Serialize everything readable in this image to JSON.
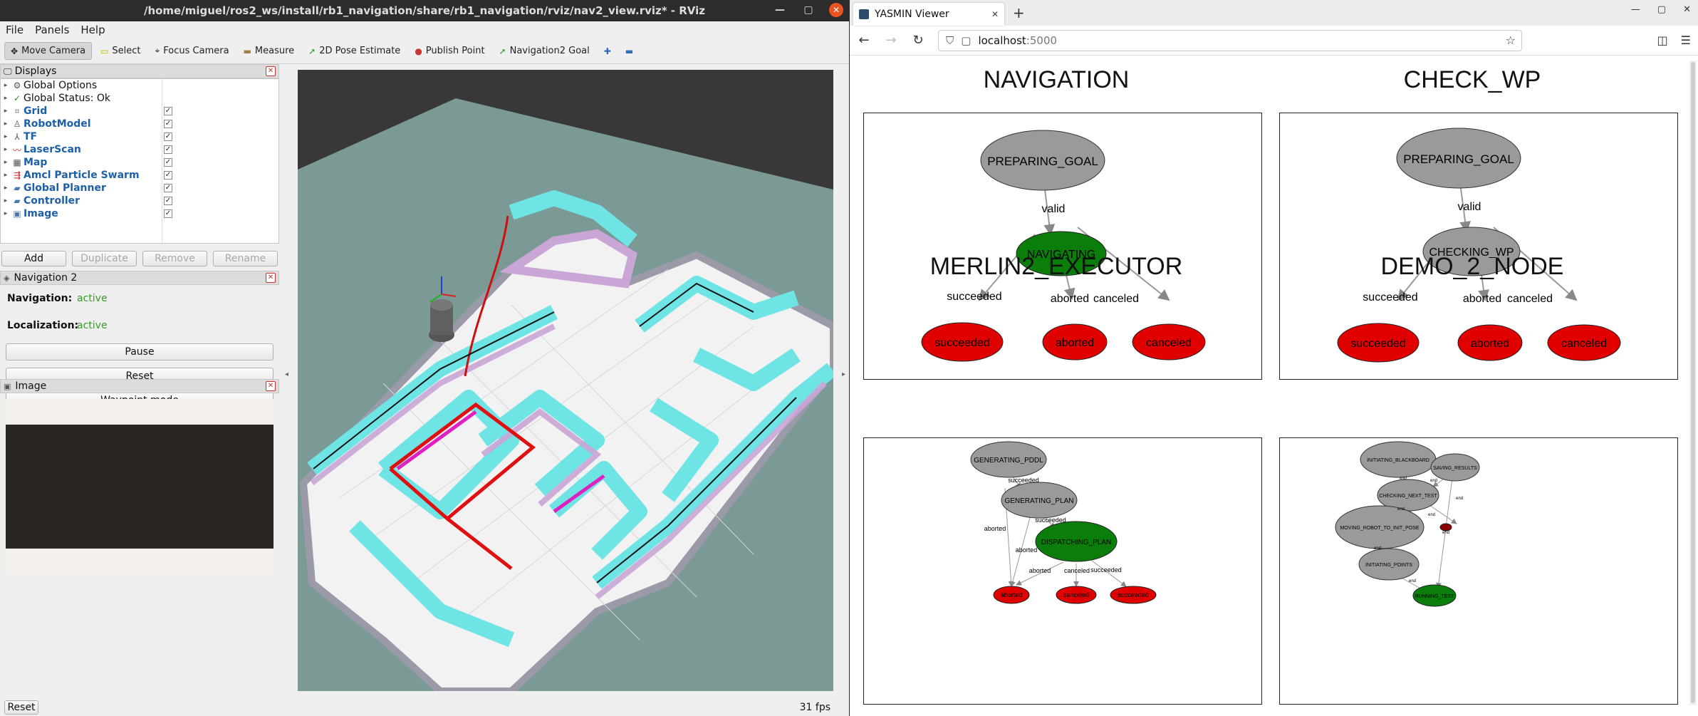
{
  "rviz": {
    "title": "/home/miguel/ros2_ws/install/rb1_navigation/share/rb1_navigation/rviz/nav2_view.rviz* - RViz",
    "menu": [
      "File",
      "Panels",
      "Help"
    ],
    "toolbar": [
      "Move Camera",
      "Select",
      "Focus Camera",
      "Measure",
      "2D Pose Estimate",
      "Publish Point",
      "Navigation2 Goal"
    ],
    "displays_title": "Displays",
    "displays": [
      {
        "label": "Global Options",
        "checked": null,
        "blue": false,
        "icon": "gear-icon"
      },
      {
        "label": "Global Status: Ok",
        "checked": null,
        "blue": false,
        "icon": "check-icon"
      },
      {
        "label": "Grid",
        "checked": true,
        "blue": true,
        "icon": "grid-icon"
      },
      {
        "label": "RobotModel",
        "checked": true,
        "blue": true,
        "icon": "robot-icon"
      },
      {
        "label": "TF",
        "checked": true,
        "blue": true,
        "icon": "tf-icon"
      },
      {
        "label": "LaserScan",
        "checked": true,
        "blue": true,
        "icon": "laser-icon"
      },
      {
        "label": "Map",
        "checked": true,
        "blue": true,
        "icon": "map-icon"
      },
      {
        "label": "Amcl Particle Swarm",
        "checked": true,
        "blue": true,
        "icon": "particles-icon"
      },
      {
        "label": "Global Planner",
        "checked": true,
        "blue": true,
        "icon": "folder-icon"
      },
      {
        "label": "Controller",
        "checked": true,
        "blue": true,
        "icon": "folder-icon"
      },
      {
        "label": "Image",
        "checked": true,
        "blue": true,
        "icon": "image-icon"
      }
    ],
    "display_buttons": [
      "Add",
      "Duplicate",
      "Remove",
      "Rename"
    ],
    "nav_panel_title": "Navigation 2",
    "navigation_label": "Navigation:",
    "navigation_value": "active",
    "localization_label": "Localization:",
    "localization_value": "active",
    "nav_buttons": [
      "Pause",
      "Reset",
      "Waypoint mode"
    ],
    "image_panel_title": "Image",
    "reset_label": "Reset",
    "fps": "31 fps"
  },
  "firefox": {
    "tab_title": "YASMIN Viewer",
    "url_host": "localhost",
    "url_port": ":5000"
  },
  "state_machines": [
    {
      "title": "NAVIGATION",
      "states": [
        {
          "label": "PREPARING_GOAL",
          "color": "#9a9a9a"
        },
        {
          "label": "NAVIGATING",
          "color": "#0a7d0a"
        },
        {
          "label": "succeeded",
          "color": "#e00000"
        },
        {
          "label": "aborted",
          "color": "#e00000"
        },
        {
          "label": "canceled",
          "color": "#e00000"
        }
      ],
      "transitions": [
        "valid",
        "succeeded",
        "aborted",
        "canceled"
      ]
    },
    {
      "title": "CHECK_WP",
      "states": [
        {
          "label": "PREPARING_GOAL",
          "color": "#9a9a9a"
        },
        {
          "label": "CHECKING_WP",
          "color": "#9a9a9a"
        },
        {
          "label": "succeeded",
          "color": "#e00000"
        },
        {
          "label": "aborted",
          "color": "#e00000"
        },
        {
          "label": "canceled",
          "color": "#e00000"
        }
      ],
      "transitions": [
        "valid",
        "succeeded",
        "aborted",
        "canceled"
      ]
    },
    {
      "title": "MERLIN2_EXECUTOR",
      "states": [
        {
          "label": "GENERATING_PDDL",
          "color": "#9a9a9a"
        },
        {
          "label": "GENERATING_PLAN",
          "color": "#9a9a9a"
        },
        {
          "label": "DISPATCHING_PLAN",
          "color": "#0a7d0a"
        },
        {
          "label": "aborted",
          "color": "#e00000"
        },
        {
          "label": "canceled",
          "color": "#e00000"
        },
        {
          "label": "succeeded",
          "color": "#e00000"
        }
      ],
      "transitions": [
        "succeeded",
        "succeeded",
        "aborted",
        "aborted",
        "aborted",
        "canceled",
        "succeeded"
      ]
    },
    {
      "title": "DEMO_2_NODE",
      "states": [
        {
          "label": "INITIATING_BLACKBOARD",
          "color": "#9a9a9a"
        },
        {
          "label": "SAVING_RESULTS",
          "color": "#9a9a9a"
        },
        {
          "label": "CHECKING_NEXT_TEST",
          "color": "#9a9a9a"
        },
        {
          "label": "MOVING_ROBOT_TO_INIT_POSE",
          "color": "#9a9a9a"
        },
        {
          "label": "INITIATING_POINTS",
          "color": "#9a9a9a"
        },
        {
          "label": "RUNNING_TEST",
          "color": "#0a7d0a"
        },
        {
          "label": "end",
          "color": "#8b0000"
        }
      ],
      "transitions": [
        "end",
        "end",
        "end",
        "end",
        "end",
        "end",
        "end"
      ]
    }
  ]
}
